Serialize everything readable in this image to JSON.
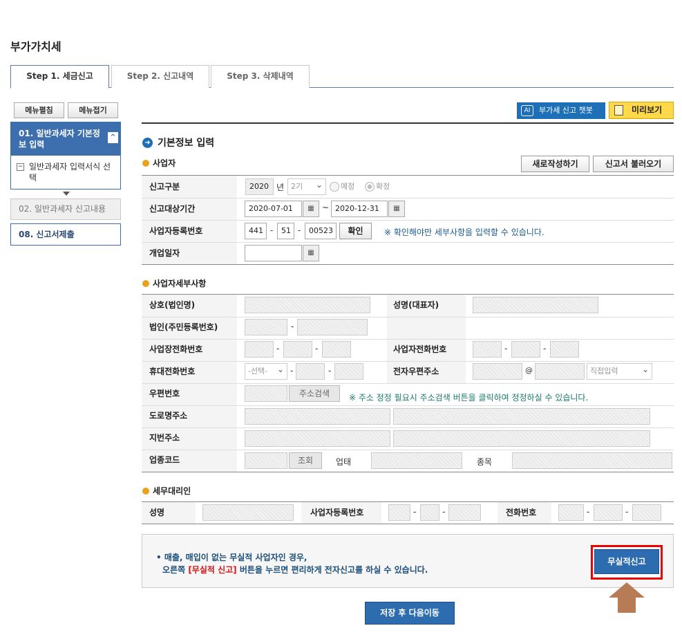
{
  "page_title": "부가가치세",
  "tabs": [
    {
      "label": "Step 1. 세금신고",
      "active": true
    },
    {
      "label": "Step 2. 신고내역",
      "active": false
    },
    {
      "label": "Step 3. 삭제내역",
      "active": false
    }
  ],
  "sidebar": {
    "expand_label": "메뉴펼침",
    "collapse_label": "메뉴접기",
    "menu1": {
      "label": "01. 일반과세자 기본정보 입력",
      "caret": "^",
      "sub_label": "일반과세자 입력서식 선택",
      "sub_icon": "−"
    },
    "menu2": {
      "label": "02. 일반과세자 신고내용"
    },
    "menu3": {
      "label": "08. 신고서제출"
    }
  },
  "toolbar": {
    "chat_label": "부가세 신고 챗봇",
    "chat_icon": "AI",
    "preview_label": "미리보기"
  },
  "section": {
    "title": "기본정보 입력",
    "title_icon": "➜"
  },
  "business": {
    "title": "사업자",
    "new_btn": "새로작성하기",
    "load_btn": "신고서 불러오기",
    "report_type_label": "신고구분",
    "year_value": "2020",
    "year_unit": "년",
    "period_value": "2기",
    "radio_prelim": "예정",
    "radio_final": "확정",
    "period_label": "신고대상기간",
    "date_from": "2020-07-01",
    "tilde": "~",
    "date_to": "2020-12-31",
    "reg_label": "사업자등록번호",
    "reg1": "441",
    "reg2": "51",
    "reg3": "00523",
    "dash": "-",
    "confirm_btn": "확인",
    "reg_note": "※ 확인해야만 세부사항을 입력할 수 있습니다.",
    "open_label": "개업일자",
    "cal_icon": "▦"
  },
  "details": {
    "title": "사업자세부사항",
    "company_label": "상호(법인명)",
    "rep_label": "성명(대표자)",
    "corp_label": "법인(주민등록번호)",
    "biz_phone_label": "사업장전화번호",
    "owner_phone_label": "사업자전화번호",
    "mobile_label": "휴대전화번호",
    "mobile_select": "-선택-",
    "email_label": "전자우편주소",
    "at": "@",
    "email_select": "직접입력",
    "zip_label": "우편번호",
    "zip_btn": "주소검색",
    "zip_note": "※ 주소 정정 필요시 주소검색 버튼을 클릭하여 정정하실 수 있습니다.",
    "road_label": "도로명주소",
    "lot_label": "지번주소",
    "code_label": "업종코드",
    "lookup_btn": "조회",
    "type_label": "업태",
    "item_label": "종목"
  },
  "agent": {
    "title": "세무대리인",
    "name_label": "성명",
    "reg_label": "사업자등록번호",
    "phone_label": "전화번호"
  },
  "info": {
    "line1": "• 매출, 매입이 없는 무실적 사업자인 경우,",
    "line2_pre": "오른쪽 ",
    "line2_red": "[무실적 신고]",
    "line2_post": " 버튼을 누르면 편리하게 전자신고를 하실 수 있습니다.",
    "no_perf_btn": "무실적신고"
  },
  "save_btn": "저장 후 다음이동",
  "colors": {
    "accent": "#2e6cb0",
    "highlight_frame": "#e00000",
    "arrow": "#b77b55",
    "preview": "#ffd94a"
  }
}
